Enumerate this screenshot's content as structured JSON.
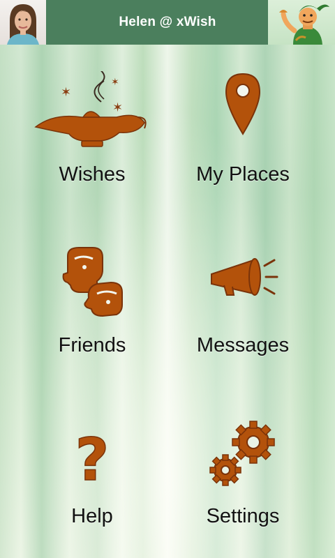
{
  "header": {
    "title": "Helen @ xWish",
    "bg_color": "#4b7f5d"
  },
  "accent_color": "#b3520b",
  "menu": [
    {
      "label": "Wishes",
      "icon": "magic-lamp-icon"
    },
    {
      "label": "My Places",
      "icon": "map-pin-icon"
    },
    {
      "label": "Friends",
      "icon": "friends-faces-icon"
    },
    {
      "label": "Messages",
      "icon": "megaphone-icon"
    },
    {
      "label": "Help",
      "icon": "question-mark-icon"
    },
    {
      "label": "Settings",
      "icon": "gears-icon"
    }
  ]
}
